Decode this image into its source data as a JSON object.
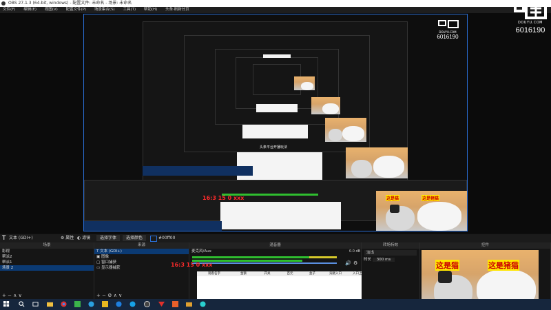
{
  "window": {
    "title": "OBS 27.1.3 (64-bit, windows) - 配置文件: 未命名 - 场景: 未命名",
    "menu": [
      "文件(F)",
      "编辑(E)",
      "视图(V)",
      "配置文件(P)",
      "场景集合(S)",
      "工具(T)",
      "帮助(H)",
      "头条·刷新分页"
    ]
  },
  "watermark": {
    "brand": "DOUYU.COM",
    "room": "6016190"
  },
  "source_bar": {
    "current_source": "文本 (GDI+)",
    "properties_label": "属性",
    "filters_label": "滤镜",
    "select_font_button": "选择字体",
    "select_color_button": "选择颜色",
    "color_hex": "#00ff00"
  },
  "panels": {
    "scenes": {
      "title": "场景",
      "items": [
        "影视",
        "帮派2",
        "帮派1",
        "场景 2"
      ]
    },
    "sources": {
      "title": "来源",
      "items": [
        "文本 (GDI+)",
        "图像",
        "窗口捕获",
        "显示器捕获"
      ]
    },
    "mixer": {
      "title": "混音器",
      "track_label": "麦克风/Aux",
      "level": "0.0 dB",
      "overlay_text": "16:3 15 0 xxx"
    },
    "transitions": {
      "title": "转场特效",
      "type": "淡出",
      "duration_label": "时长",
      "duration": "300 ms"
    },
    "controls": {
      "title": "控件"
    }
  },
  "table": {
    "headers": [
      "观看名字",
      "金额",
      "开关",
      "百元",
      "盒子",
      "贡献入口",
      "入口上限"
    ]
  },
  "inner_overlay_text": "头条平台开播玩法",
  "cat_caption": {
    "left": "这是猫",
    "right": "这是猪猫"
  },
  "colors": {
    "accent": "#2a6fd6",
    "meter_green": "#2fbf2f",
    "red_text": "#ff2b2b",
    "selection": "#0b3a73"
  }
}
